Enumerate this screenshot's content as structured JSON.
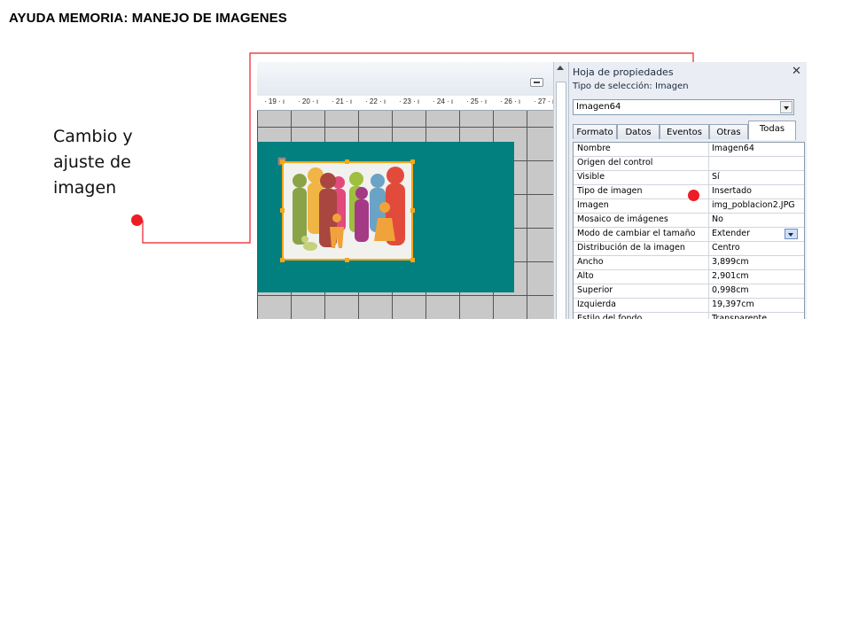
{
  "slide": {
    "title": "AYUDA MEMORIA: MANEJO DE IMAGENES",
    "annotation": "Cambio y ajuste de imagen",
    "accent_color": "#ee1c24"
  },
  "designer": {
    "ruler_labels": [
      "19",
      "20",
      "21",
      "22",
      "23",
      "24",
      "25",
      "26",
      "27"
    ],
    "image_description_icon": "family-group-picture",
    "section_color": "#027f7f",
    "selection_color": "#f4a81c"
  },
  "property_sheet": {
    "title": "Hoja de propiedades",
    "close_icon": "close-icon",
    "selection_type_label": "Tipo de selección:",
    "selection_type_value": "Imagen",
    "object_selected": "Imagen64",
    "tabs": [
      "Formato",
      "Datos",
      "Eventos",
      "Otras",
      "Todas"
    ],
    "active_tab": "Todas",
    "rows": [
      {
        "name": "Nombre",
        "value": "Imagen64"
      },
      {
        "name": "Origen del control",
        "value": ""
      },
      {
        "name": "Visible",
        "value": "Sí"
      },
      {
        "name": "Tipo de imagen",
        "value": "Insertado"
      },
      {
        "name": "Imagen",
        "value": "img_poblacion2.JPG"
      },
      {
        "name": "Mosaico de imágenes",
        "value": "No"
      },
      {
        "name": "Modo de cambiar el tamaño",
        "value": "Extender"
      },
      {
        "name": "Distribución de la imagen",
        "value": "Centro"
      },
      {
        "name": "Ancho",
        "value": "3,899cm"
      },
      {
        "name": "Alto",
        "value": "2,901cm"
      },
      {
        "name": "Superior",
        "value": "0,998cm"
      },
      {
        "name": "Izquierda",
        "value": "19,397cm"
      },
      {
        "name": "Estilo del fondo",
        "value": "Transparente"
      }
    ]
  }
}
